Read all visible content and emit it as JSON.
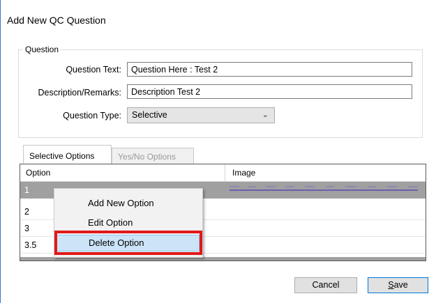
{
  "window": {
    "title": "Add New QC Question"
  },
  "question_group": {
    "legend": "Question",
    "question_text_label": "Question Text:",
    "question_text_value": "Question Here : Test 2",
    "description_label": "Description/Remarks:",
    "description_value": "Description Test 2",
    "type_label": "Question Type:",
    "type_value": "Selective"
  },
  "tabs": [
    {
      "label": "Selective Options",
      "active": true
    },
    {
      "label": "Yes/No Options",
      "active": false
    }
  ],
  "grid": {
    "columns": [
      "Option",
      "Image"
    ],
    "rows": [
      "1",
      "2",
      "3",
      "3.5"
    ]
  },
  "context_menu": {
    "items": [
      "Add New Option",
      "Edit Option",
      "Delete Option"
    ],
    "highlighted": "Delete Option"
  },
  "buttons": {
    "cancel": "Cancel",
    "save_first": "S",
    "save_rest": "ave"
  },
  "colors": {
    "highlight_box": "#e01919",
    "selected_row": "#a0a0a0",
    "menu_hover": "#cce4f7"
  }
}
